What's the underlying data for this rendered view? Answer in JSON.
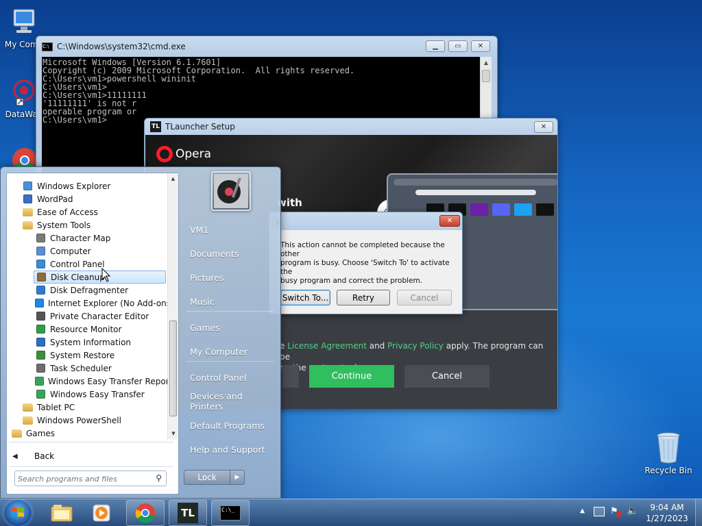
{
  "desktop": {
    "icons": [
      {
        "label": "My Comp"
      },
      {
        "label": "DataWag"
      },
      {
        "label": "Recycle Bin"
      }
    ]
  },
  "cmd": {
    "title": "C:\\Windows\\system32\\cmd.exe",
    "lines": [
      "Microsoft Windows [Version 6.1.7601]",
      "Copyright (c) 2009 Microsoft Corporation.  All rights reserved.",
      "",
      "C:\\Users\\vm1>powershell wininit",
      "",
      "C:\\Users\\vm1>",
      "C:\\Users\\vm1>11111111",
      "'11111111' is not r",
      "operable program or",
      "",
      "C:\\Users\\vm1>"
    ]
  },
  "tlauncher": {
    "title": "TLauncher Setup",
    "logo": "TL",
    "opera_brand": "Opera",
    "headline_fragment": "with",
    "legal": {
      "prefix": "e ",
      "license": "License Agreement",
      "and": " and ",
      "privacy": "Privacy Policy",
      "suffix": " apply. The program can be",
      "line2": "ng the system tools"
    },
    "continue_label": "Continue",
    "cancel_label": "Cancel"
  },
  "busy_dialog": {
    "title": "y",
    "message_lines": [
      "This action cannot be completed because the other",
      "program is busy. Choose 'Switch To' to activate the",
      "busy program and correct the problem."
    ],
    "switch_label": "Switch To...",
    "retry_label": "Retry",
    "cancel_label": "Cancel"
  },
  "start_menu": {
    "programs": [
      {
        "label": "Windows Explorer",
        "icon": "explorer-icon",
        "indent": 1
      },
      {
        "label": "WordPad",
        "icon": "wordpad-icon",
        "indent": 1
      },
      {
        "label": "Ease of Access",
        "icon": "folder-icon",
        "indent": 1
      },
      {
        "label": "System Tools",
        "icon": "folder-icon",
        "indent": 1
      },
      {
        "label": "Character Map",
        "icon": "charmap-icon",
        "indent": 2
      },
      {
        "label": "Computer",
        "icon": "computer-icon",
        "indent": 2
      },
      {
        "label": "Control Panel",
        "icon": "control-panel-icon",
        "indent": 2
      },
      {
        "label": "Disk Cleanup",
        "icon": "disk-cleanup-icon",
        "indent": 2,
        "selected": true
      },
      {
        "label": "Disk Defragmenter",
        "icon": "defrag-icon",
        "indent": 2
      },
      {
        "label": "Internet Explorer (No Add-ons)",
        "icon": "ie-icon",
        "indent": 2
      },
      {
        "label": "Private Character Editor",
        "icon": "char-editor-icon",
        "indent": 2
      },
      {
        "label": "Resource Monitor",
        "icon": "resource-monitor-icon",
        "indent": 2
      },
      {
        "label": "System Information",
        "icon": "system-info-icon",
        "indent": 2
      },
      {
        "label": "System Restore",
        "icon": "system-restore-icon",
        "indent": 2
      },
      {
        "label": "Task Scheduler",
        "icon": "task-scheduler-icon",
        "indent": 2
      },
      {
        "label": "Windows Easy Transfer Reports",
        "icon": "easy-transfer-icon",
        "indent": 2
      },
      {
        "label": "Windows Easy Transfer",
        "icon": "easy-transfer-icon",
        "indent": 2
      },
      {
        "label": "Tablet PC",
        "icon": "folder-icon",
        "indent": 1
      },
      {
        "label": "Windows PowerShell",
        "icon": "folder-icon",
        "indent": 1
      },
      {
        "label": "Games",
        "icon": "folder-icon",
        "indent": 0
      }
    ],
    "back_label": "Back",
    "search_placeholder": "Search programs and files",
    "right_items": [
      {
        "label": "VM1"
      },
      {
        "label": "Documents"
      },
      {
        "label": "Pictures"
      },
      {
        "label": "Music"
      },
      {
        "label": "Games"
      },
      {
        "label": "My Computer"
      },
      {
        "label": "Control Panel"
      },
      {
        "label": "Devices and Printers"
      },
      {
        "label": "Default Programs"
      },
      {
        "label": "Help and Support"
      }
    ],
    "lock_label": "Lock"
  },
  "taskbar": {
    "time": "9:04 AM",
    "date": "1/27/2023",
    "tl_label": "TL",
    "cmd_label": "C:\\_"
  }
}
